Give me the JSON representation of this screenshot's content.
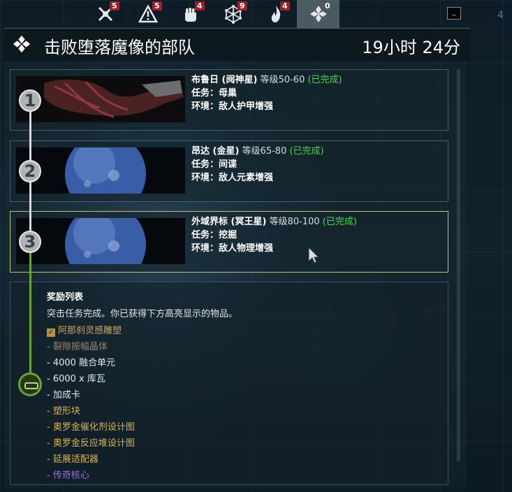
{
  "tabs": [
    {
      "icon": "crossed-swords-icon",
      "badge": "5"
    },
    {
      "icon": "warning-triangle-icon",
      "badge": "5"
    },
    {
      "icon": "fist-icon",
      "badge": "4"
    },
    {
      "icon": "network-hexagon-icon",
      "badge": "9"
    },
    {
      "icon": "flame-icon",
      "badge": "4"
    },
    {
      "icon": "sortie-icon",
      "badge": "0",
      "active": true
    }
  ],
  "corner_number": "4",
  "header": {
    "icon": "sortie-diamond-icon",
    "title": "击败堕落魔像的部队",
    "timer": "19小时  24分"
  },
  "missions": [
    {
      "index": "1",
      "node": "布鲁日 (阋神星)",
      "level": "等级50-60",
      "status": "(已完成)",
      "task_label": "任务：",
      "task": "母巢",
      "env_label": "环境：",
      "env": "敌人护甲增强"
    },
    {
      "index": "2",
      "node": "昂达 (金星)",
      "level": "等级65-80",
      "status": "(已完成)",
      "task_label": "任务：",
      "task": "间谍",
      "env_label": "环境：",
      "env": "敌人元素增强"
    },
    {
      "index": "3",
      "node": "外域界标 (冥王星)",
      "level": "等级80-100",
      "status": "(已完成)",
      "task_label": "任务：",
      "task": "挖掘",
      "env_label": "环境：",
      "env": "敌人物理增强"
    }
  ],
  "rewards": {
    "title": "奖励列表",
    "description": "突击任务完成。你已获得下方高亮显示的物品。",
    "items": [
      {
        "text": "阿那刹灵感雕塑",
        "checked": true,
        "color": "#c9a56a"
      },
      {
        "text": "- 裂隙振幅晶体",
        "color": "#a0826a"
      },
      {
        "text": "- 4000 融合单元",
        "color": "#e4e8ea"
      },
      {
        "text": "- 6000 x 库瓦",
        "color": "#e4e8ea"
      },
      {
        "text": "- 加成卡",
        "color": "#e4e8ea"
      },
      {
        "text": "- 塑形块",
        "color": "#d8b35a"
      },
      {
        "text": "- 奥罗金催化剂设计图",
        "color": "#d8b35a"
      },
      {
        "text": "- 奥罗金反应堆设计图",
        "color": "#d8b35a"
      },
      {
        "text": "- 延展适配器",
        "color": "#d8b35a"
      },
      {
        "text": "- 传奇核心",
        "color": "#9a6fd6"
      }
    ]
  }
}
